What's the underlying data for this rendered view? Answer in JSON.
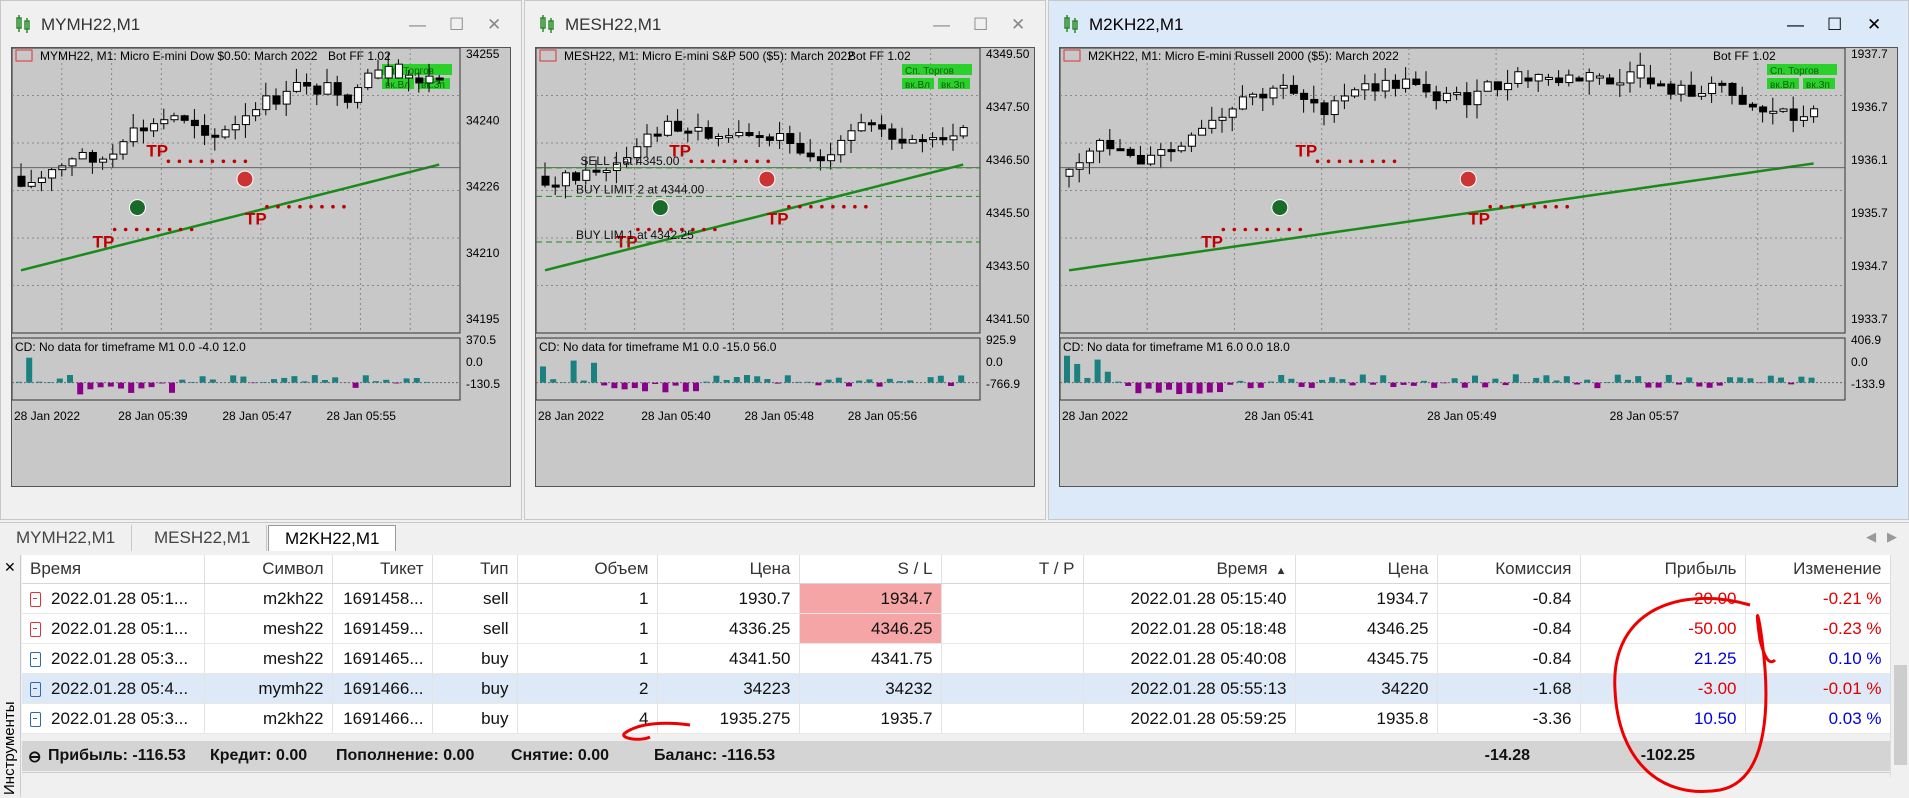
{
  "windows": [
    {
      "title": "MYMH22,M1",
      "header": "MYMH22, M1:  Micro E-mini Dow $0.50: March 2022",
      "bot": "Bot FF 1.02",
      "prices": [
        "34255",
        "34240",
        "34226",
        "34210",
        "34195"
      ],
      "ind_prices": [
        "370.5",
        "0.0",
        "-130.5"
      ],
      "ind_text": "CD: No data for timeframe M1 0.0 -4.0 12.0",
      "times": [
        "28 Jan 2022",
        "28 Jan 05:39",
        "28 Jan 05:47",
        "28 Jan 05:55"
      ],
      "tp_label": "TP",
      "side_tag": ""
    },
    {
      "title": "MESH22,M1",
      "header": "MESH22, M1:  Micro E-mini S&P 500 ($5): March 2022",
      "bot": "Bot FF 1.02",
      "prices": [
        "4349.50",
        "4347.50",
        "4346.50",
        "4345.50",
        "4343.50",
        "4341.50"
      ],
      "ind_prices": [
        "925.9",
        "0.0",
        "-766.9"
      ],
      "ind_text": "CD: No data for timeframe M1 0.0 -15.0 56.0",
      "times": [
        "28 Jan 2022",
        "28 Jan 05:40",
        "28 Jan 05:48",
        "28 Jan 05:56"
      ],
      "tp_label": "TP",
      "orders": [
        "SELL    1 at 4345.00",
        "BUY LIMIT 2 at 4344.00",
        "BUY LIM    1 at 4342.25"
      ]
    },
    {
      "title": "M2KH22,M1",
      "header": "M2KH22, M1:  Micro E-mini Russell 2000 ($5): March 2022",
      "bot": "Bot FF 1.02",
      "prices": [
        "1937.7",
        "1936.7",
        "1936.1",
        "1935.7",
        "1934.7",
        "1933.7"
      ],
      "ind_prices": [
        "406.9",
        "0.0",
        "-133.9"
      ],
      "ind_text": "CD: No data for timeframe M1 6.0 0.0 18.0",
      "times": [
        "28 Jan 2022",
        "28 Jan 05:41",
        "28 Jan 05:49",
        "28 Jan 05:57"
      ],
      "tp_label": "TP"
    }
  ],
  "panel_buttons": [
    "Сп. Торгов",
    "вк.Вл",
    "вк.Зп"
  ],
  "tabs": [
    "MYMH22,M1",
    "MESH22,M1",
    "M2KH22,M1"
  ],
  "table": {
    "headers": [
      "Время",
      "Символ",
      "Тикет",
      "Тип",
      "Объем",
      "Цена",
      "S / L",
      "T / P",
      "Время",
      "Цена",
      "Комиссия",
      "Прибыль",
      "Изменение"
    ],
    "sort_indicator": "▲",
    "rows": [
      [
        "2022.01.28 05:1...",
        "m2kh22",
        "1691458...",
        "sell",
        "1",
        "1930.7",
        "1934.7",
        "",
        "2022.01.28 05:15:40",
        "1934.7",
        "-0.84",
        "-20.00",
        "-0.21 %"
      ],
      [
        "2022.01.28 05:1...",
        "mesh22",
        "1691459...",
        "sell",
        "1",
        "4336.25",
        "4346.25",
        "",
        "2022.01.28 05:18:48",
        "4346.25",
        "-0.84",
        "-50.00",
        "-0.23 %"
      ],
      [
        "2022.01.28 05:3...",
        "mesh22",
        "1691465...",
        "buy",
        "1",
        "4341.50",
        "4341.75",
        "",
        "2022.01.28 05:40:08",
        "4345.75",
        "-0.84",
        "21.25",
        "0.10 %"
      ],
      [
        "2022.01.28 05:4...",
        "mymh22",
        "1691466...",
        "buy",
        "2",
        "34223",
        "34232",
        "",
        "2022.01.28 05:55:13",
        "34220",
        "-1.68",
        "-3.00",
        "-0.01 %"
      ],
      [
        "2022.01.28 05:3...",
        "m2kh22",
        "1691466...",
        "buy",
        "4",
        "1935.275",
        "1935.7",
        "",
        "2022.01.28 05:59:25",
        "1935.8",
        "-3.36",
        "10.50",
        "0.03 %"
      ]
    ]
  },
  "summary": {
    "profit": "Прибыль: -116.53",
    "credit": "Кредит: 0.00",
    "deposit": "Пополнение: 0.00",
    "withdraw": "Снятие: 0.00",
    "balance": "Баланс: -116.53",
    "commission_total": "-14.28",
    "profit_total": "-102.25"
  },
  "side_label": "Инструменты",
  "colors": {
    "negative": "#e00000",
    "positive": "#0000dd",
    "sl_highlight": "#f5a5a5",
    "ma_line": "#1a8a1a",
    "tp_color": "#c00000",
    "histo_pos": "#1a8080",
    "histo_neg": "#8a008a"
  }
}
